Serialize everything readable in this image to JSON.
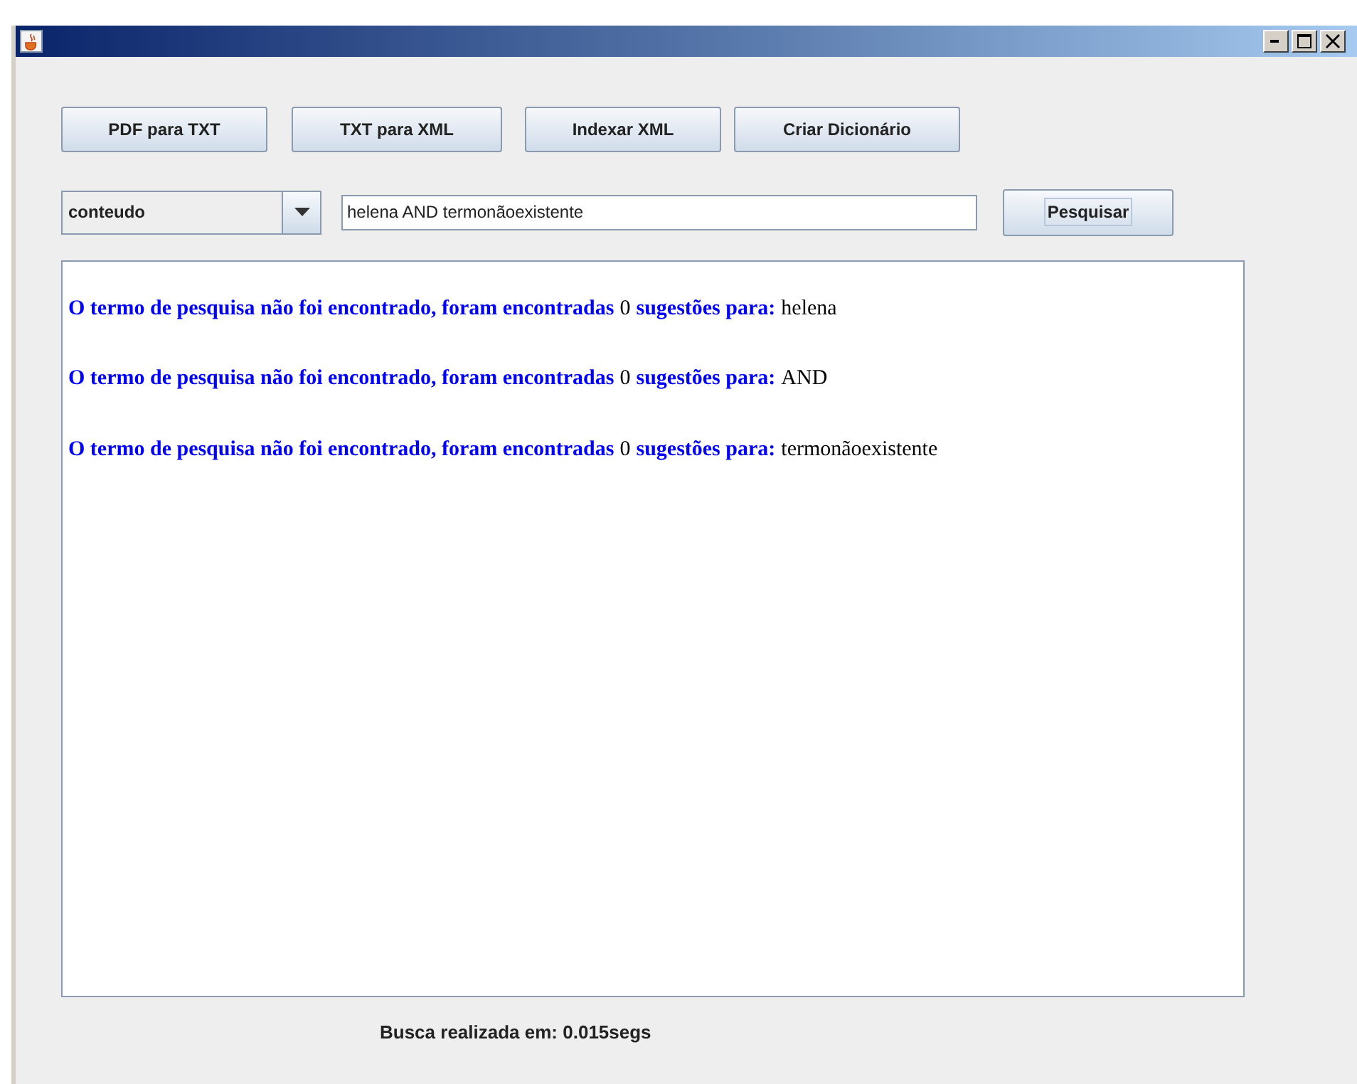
{
  "toolbar": {
    "buttons": [
      "PDF para TXT",
      "TXT para XML",
      "Indexar XML",
      "Criar Dicionário"
    ]
  },
  "search": {
    "field": "conteudo",
    "query": "helena AND termonãoexistente",
    "button": "Pesquisar"
  },
  "results": [
    {
      "message": "O termo de pesquisa não foi encontrado, foram encontradas",
      "count": "0",
      "label": "sugestões para:",
      "term": "helena"
    },
    {
      "message": "O termo de pesquisa não foi encontrado, foram encontradas",
      "count": "0",
      "label": "sugestões para:",
      "term": "AND"
    },
    {
      "message": "O termo de pesquisa não foi encontrado, foram encontradas",
      "count": "0",
      "label": "sugestões para:",
      "term": "termonãoexistente"
    }
  ],
  "status_bar": "Busca realizada em: 0.015segs"
}
